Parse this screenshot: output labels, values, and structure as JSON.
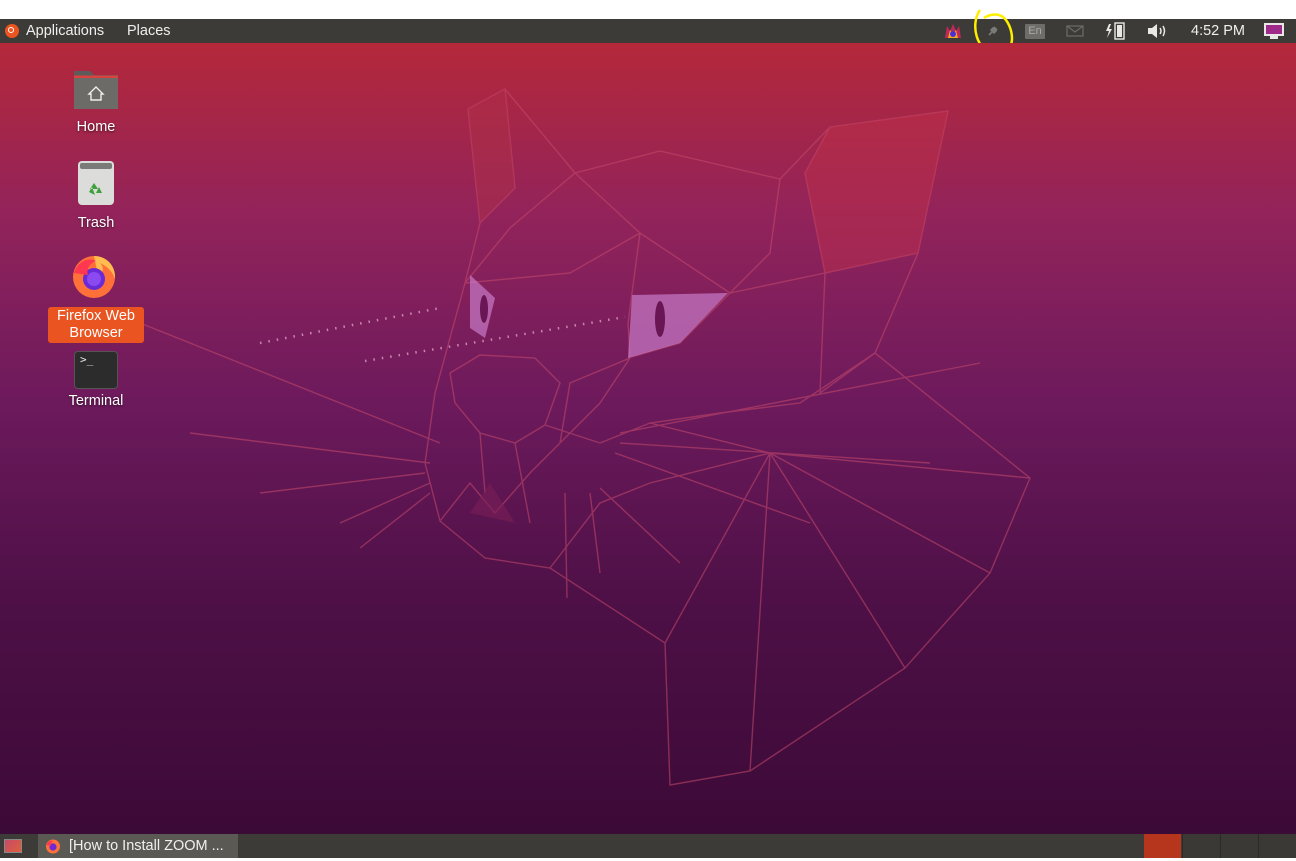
{
  "top_panel": {
    "applications_label": "Applications",
    "places_label": "Places",
    "keyboard_layout": "En",
    "clock": "4:52 PM"
  },
  "desktop_icons": [
    {
      "label": "Home"
    },
    {
      "label": "Trash"
    },
    {
      "label": "Firefox Web Browser"
    },
    {
      "label": "Terminal"
    }
  ],
  "terminal_glyph": ">_",
  "taskbar": {
    "window_title": "[How to Install ZOOM ..."
  },
  "colors": {
    "panel": "#3c3b37",
    "accent": "#e95420",
    "annotation": "#ffee00"
  },
  "icons": [
    "ubuntu-logo",
    "firefox-icon",
    "plug-icon",
    "keyboard-layout-indicator",
    "mail-icon",
    "battery-icon",
    "volume-icon",
    "system-monitor-icon",
    "home-folder-icon",
    "trash-icon",
    "terminal-icon",
    "show-desktop-icon"
  ]
}
